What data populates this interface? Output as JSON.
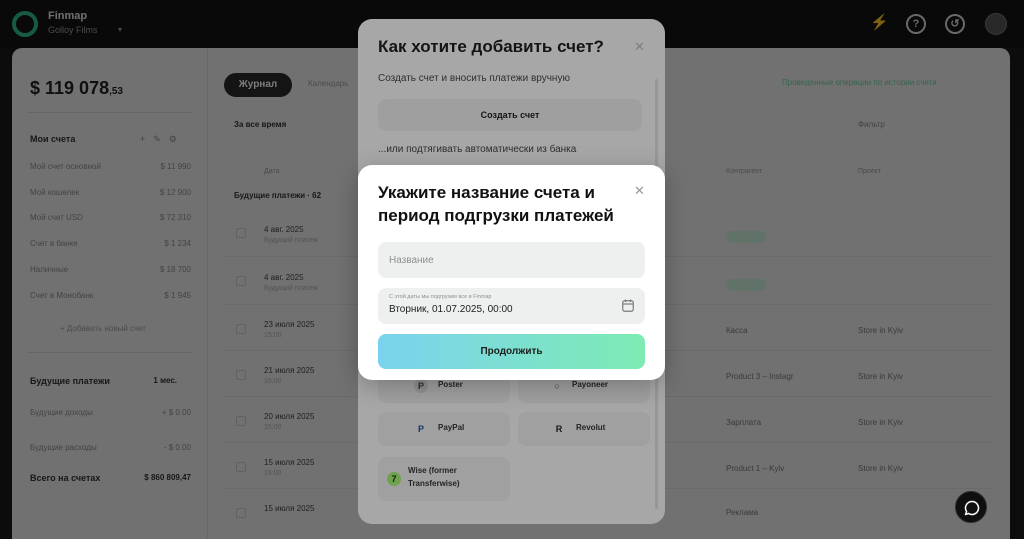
{
  "app": {
    "brand": "Finmap",
    "workspace": "Golloy Films",
    "colors": {
      "brand": "#2fbf8a",
      "accent_from": "#7ad3ee",
      "accent_to": "#7eebb3"
    }
  },
  "topbar": {
    "icons": [
      "flash-icon",
      "help-icon",
      "history-icon",
      "avatar"
    ]
  },
  "sidebar": {
    "balance_main": "$ 119 078",
    "balance_cents": ",53",
    "accounts_title": "Мои счета",
    "accounts": [
      {
        "label": "Мой счет основной",
        "value": "$ 11 990"
      },
      {
        "label": "Мой кошелек",
        "value": "$ 12 900"
      },
      {
        "label": "Мой счет USD",
        "value": "$ 72 310"
      },
      {
        "label": "Счет в банке",
        "value": "$ 1 234"
      },
      {
        "label": "Наличные",
        "value": "$ 18 700"
      },
      {
        "label": "Счет в Монобанк",
        "value": "$ 1 945"
      }
    ],
    "add_account": "+ Добавить новый счет",
    "future_title": "Будущие платежи",
    "future_period": "1 мес.",
    "future_rows": [
      {
        "label": "Будущие доходы",
        "value": "+ $ 0.00"
      },
      {
        "label": "Будущие расходы",
        "value": "- $ 0.00"
      }
    ],
    "total_label": "Всего на счетах",
    "total_value": "$ 860 809,47"
  },
  "content": {
    "tab_active": "Журнал",
    "tab_other": "Календарь",
    "info_right": "Проведенные операции по истории счета",
    "filter_period": "За все время",
    "ctl_right": "Фильтр",
    "columns": [
      "Дата",
      "Контрагент",
      "Проект"
    ],
    "group_label": "Будущие платежи · 62",
    "rows": [
      {
        "date": "4 авг. 2025",
        "sub": "Будущий платеж",
        "mid": "",
        "right": ""
      },
      {
        "date": "4 авг. 2025",
        "sub": "Будущий платеж",
        "mid": "",
        "right": ""
      },
      {
        "date": "23 июля 2025",
        "sub": "15:00",
        "mid": "Касса",
        "right": "Store in Kyiv"
      },
      {
        "date": "21 июля 2025",
        "sub": "15:00",
        "mid": "Product 3 – Instagr",
        "right": "Store in Kyiv"
      },
      {
        "date": "20 июля 2025",
        "sub": "15:00",
        "mid": "Зарплата",
        "right": "Store in Kyiv"
      },
      {
        "date": "15 июля 2025",
        "sub": "15:00",
        "mid": "Product 1 – Kyiv",
        "right": "Store in Kyiv"
      },
      {
        "date": "15 июля 2025",
        "sub": "",
        "mid": "Реклама",
        "right": ""
      }
    ]
  },
  "modal_choice": {
    "title": "Как хотите добавить счет?",
    "manual_text": "Создать счет и вносить платежи вручную",
    "create_button": "Создать счет",
    "auto_text": "...или подтягивать автоматически из банка",
    "banks": [
      {
        "name": "Poster",
        "logo": "P"
      },
      {
        "name": "Payoneer",
        "logo": "○"
      },
      {
        "name": "PayPal",
        "logo": "P"
      },
      {
        "name": "Revolut",
        "logo": "R"
      },
      {
        "name": "Wise (former",
        "name2": "Transferwise)",
        "logo": "7"
      }
    ]
  },
  "modal_name": {
    "title": "Укажите название счета и период подгрузки платежей",
    "name_placeholder": "Название",
    "name_value": "",
    "date_label": "С этой даты мы подгрузим все в Finmap",
    "date_value": "Вторник, 01.07.2025, 00:00",
    "continue_button": "Продолжить"
  }
}
